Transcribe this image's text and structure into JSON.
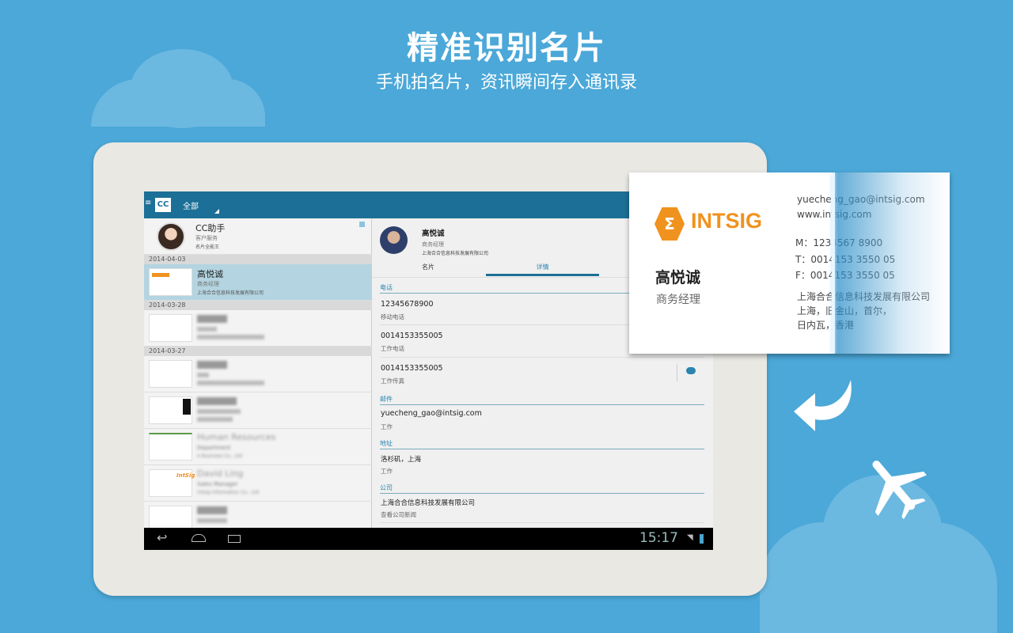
{
  "banner": {
    "title": "精准识别名片",
    "subtitle": "手机拍名片，资讯瞬间存入通讯录"
  },
  "app": {
    "logo": "CC",
    "menu_icon": "hamburger-icon",
    "filter": "全部"
  },
  "assistant": {
    "name": "CC助手",
    "role": "客户服务",
    "desc": "名片全能王"
  },
  "groups": [
    {
      "date": "2014-04-03"
    },
    {
      "date": "2014-03-28"
    },
    {
      "date": "2014-03-27"
    }
  ],
  "contacts": [
    {
      "name": "高悦诚",
      "title": "商务经理",
      "company": "上海合合信息科技发展有限公司",
      "selected": true
    },
    {
      "name": "Human Resources",
      "title": "Department",
      "company": "e Business Co., Ltd"
    },
    {
      "name": "David Ling",
      "title": "Sales Manager",
      "company": "Intsig Information Co., Ltd"
    }
  ],
  "detail": {
    "name": "高悦诚",
    "title": "商务经理",
    "company": "上海合合信息科技发展有限公司",
    "tabs": [
      {
        "label": "名片",
        "active": false
      },
      {
        "label": "详情",
        "active": true
      }
    ],
    "phone_section": "电话",
    "phones": [
      {
        "value": "12345678900",
        "type": "移动电话"
      },
      {
        "value": "0014153355005",
        "type": "工作电话"
      },
      {
        "value": "0014153355005",
        "type": "工作传真"
      }
    ],
    "email_section": "邮件",
    "email": "yuecheng_gao@intsig.com",
    "email_type": "工作",
    "address_section": "地址",
    "address": "洛杉矶，上海",
    "address_type": "工作",
    "company_section": "公司",
    "company_name": "上海合合信息科技发展有限公司",
    "company_news": "查看公司新闻"
  },
  "statusbar": {
    "time": "15:17"
  },
  "card": {
    "brand": "INTSIG",
    "name": "高悦诚",
    "title": "商务经理",
    "email": "yuecheng_gao@intsig.com",
    "web": "www.intsig.com",
    "mobile": "M：1234567 8900",
    "tel": "T：0014153 3550 05",
    "fax": "F：0014153 3550 05",
    "company": "上海合合信息科技发展有限公司",
    "addr1": "上海，旧金山，首尔，",
    "addr2": "日内瓦，香港"
  },
  "colors": {
    "background": "#4ba8d8",
    "appbar": "#1c6f96",
    "brand_orange": "#f0921e",
    "selected_row": "#b3d4e0"
  }
}
